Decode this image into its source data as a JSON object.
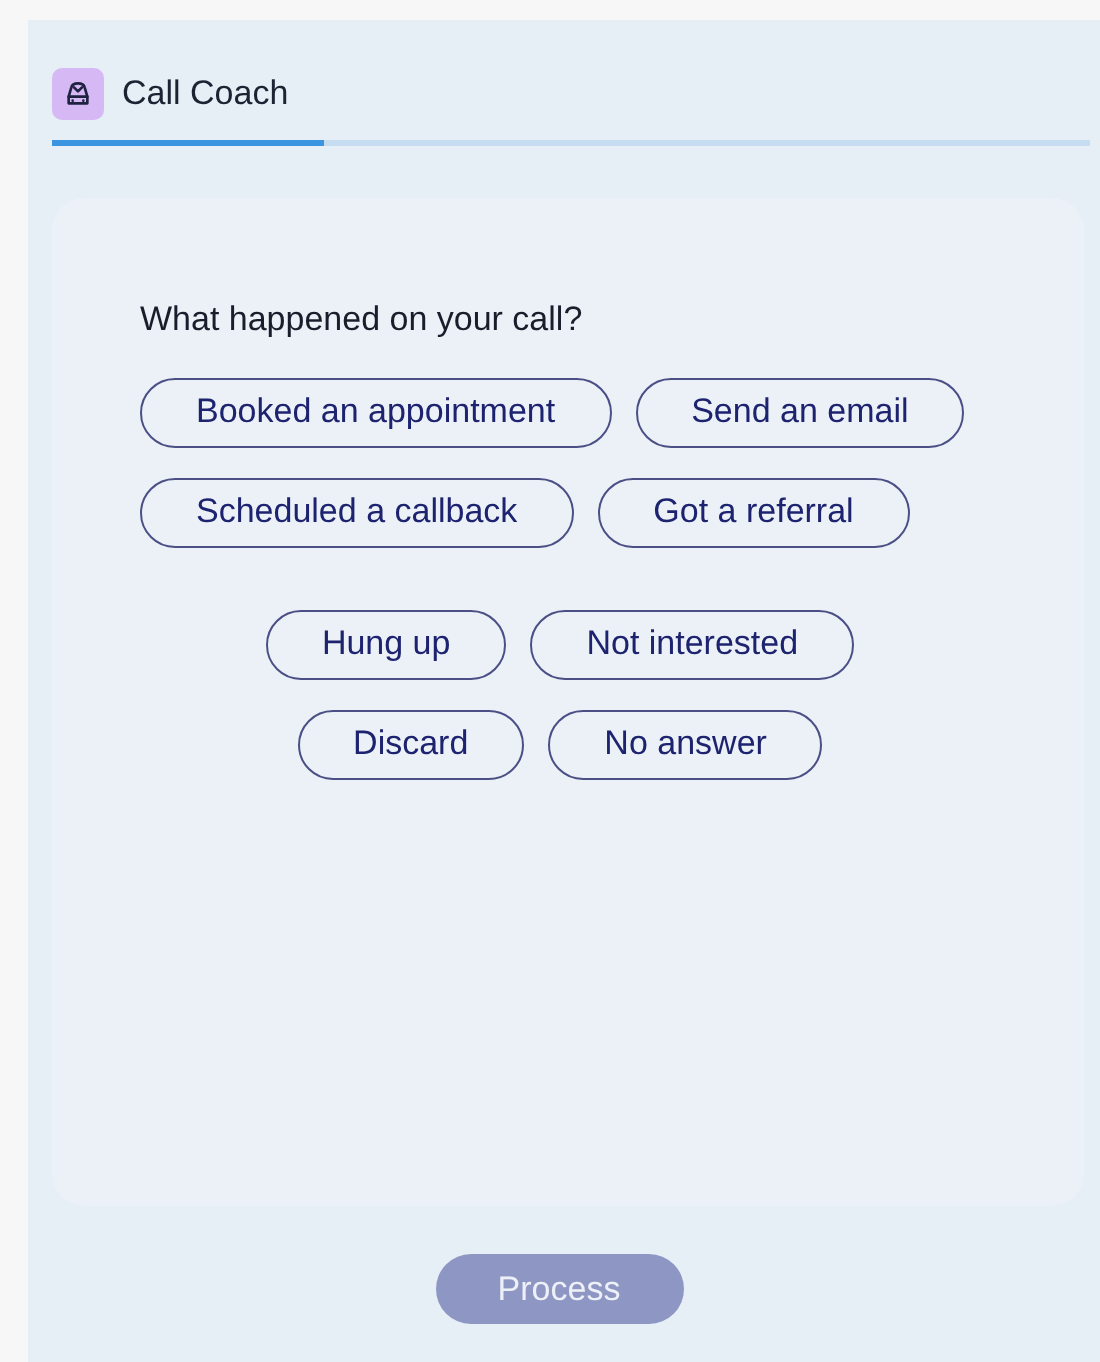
{
  "tabs": [
    {
      "label": "Call Coach",
      "selected": true
    }
  ],
  "question": "What happened on your call?",
  "groups": [
    {
      "kind": "flush",
      "rows": [
        [
          "Booked an appointment",
          "Send an email"
        ],
        [
          "Scheduled a callback",
          "Got a referral"
        ]
      ]
    },
    {
      "kind": "centered",
      "rows": [
        [
          "Hung up",
          "Not interested"
        ],
        [
          "Discard",
          "No answer"
        ]
      ]
    }
  ],
  "process_button": {
    "label": "Process",
    "disabled": true
  }
}
